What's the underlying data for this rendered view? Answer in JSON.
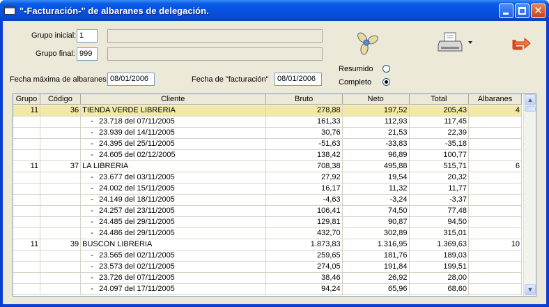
{
  "window": {
    "title": "\"-Facturación-\" de albaranes de delegación."
  },
  "filters": {
    "grupo_inicial_label": "Grupo inicial:",
    "grupo_inicial_value": "1",
    "grupo_final_label": "Grupo final:",
    "grupo_final_value": "999",
    "fecha_max_label": "Fecha máxima de albaranes:",
    "fecha_max_value": "08/01/2006",
    "fecha_fact_label": "Fecha de \"facturación\"",
    "fecha_fact_value": "08/01/2006"
  },
  "options": {
    "resumido_label": "Resumido",
    "completo_label": "Completo",
    "selected": "completo"
  },
  "toolbar": {
    "process_icon": "propeller-icon",
    "print_icon": "printer-icon",
    "exit_icon": "exit-arrow-icon"
  },
  "table": {
    "headers": [
      "Grupo",
      "Código",
      "Cliente",
      "Bruto",
      "Neto",
      "Total",
      "Albaranes"
    ],
    "rows": [
      {
        "type": "client",
        "grupo": "11",
        "codigo": "36",
        "cliente": "TIENDA VERDE LIBRERIA",
        "bruto": "278,88",
        "neto": "197,52",
        "total": "205,43",
        "albaranes": "4",
        "selected": true
      },
      {
        "type": "detail",
        "cliente": "23.718 del 07/11/2005",
        "bruto": "161,33",
        "neto": "112,93",
        "total": "117,45"
      },
      {
        "type": "detail",
        "cliente": "23.939 del 14/11/2005",
        "bruto": "30,76",
        "neto": "21,53",
        "total": "22,39"
      },
      {
        "type": "detail",
        "cliente": "24.395 del 25/11/2005",
        "bruto": "-51,63",
        "neto": "-33,83",
        "total": "-35,18"
      },
      {
        "type": "detail",
        "cliente": "24.605 del 02/12/2005",
        "bruto": "138,42",
        "neto": "96,89",
        "total": "100,77"
      },
      {
        "type": "client",
        "grupo": "11",
        "codigo": "37",
        "cliente": "LA LIBRERIA",
        "bruto": "708,38",
        "neto": "495,88",
        "total": "515,71",
        "albaranes": "6"
      },
      {
        "type": "detail",
        "cliente": "23.677 del 03/11/2005",
        "bruto": "27,92",
        "neto": "19,54",
        "total": "20,32"
      },
      {
        "type": "detail",
        "cliente": "24.002 del 15/11/2005",
        "bruto": "16,17",
        "neto": "11,32",
        "total": "11,77"
      },
      {
        "type": "detail",
        "cliente": "24.149 del 18/11/2005",
        "bruto": "-4,63",
        "neto": "-3,24",
        "total": "-3,37"
      },
      {
        "type": "detail",
        "cliente": "24.257 del 23/11/2005",
        "bruto": "106,41",
        "neto": "74,50",
        "total": "77,48"
      },
      {
        "type": "detail",
        "cliente": "24.485 del 29/11/2005",
        "bruto": "129,81",
        "neto": "90,87",
        "total": "94,50"
      },
      {
        "type": "detail",
        "cliente": "24.486 del 29/11/2005",
        "bruto": "432,70",
        "neto": "302,89",
        "total": "315,01"
      },
      {
        "type": "client",
        "grupo": "11",
        "codigo": "39",
        "cliente": "BUSCON LIBRERIA",
        "bruto": "1.873,83",
        "neto": "1.316,95",
        "total": "1.369,63",
        "albaranes": "10"
      },
      {
        "type": "detail",
        "cliente": "23.565 del 02/11/2005",
        "bruto": "259,65",
        "neto": "181,76",
        "total": "189,03"
      },
      {
        "type": "detail",
        "cliente": "23.573 del 02/11/2005",
        "bruto": "274,05",
        "neto": "191,84",
        "total": "199,51"
      },
      {
        "type": "detail",
        "cliente": "23.726 del 07/11/2005",
        "bruto": "38,46",
        "neto": "26,92",
        "total": "28,00"
      },
      {
        "type": "detail",
        "cliente": "24.097 del 17/11/2005",
        "bruto": "94,24",
        "neto": "65,96",
        "total": "68,60"
      }
    ],
    "detail_prefix": "-"
  }
}
